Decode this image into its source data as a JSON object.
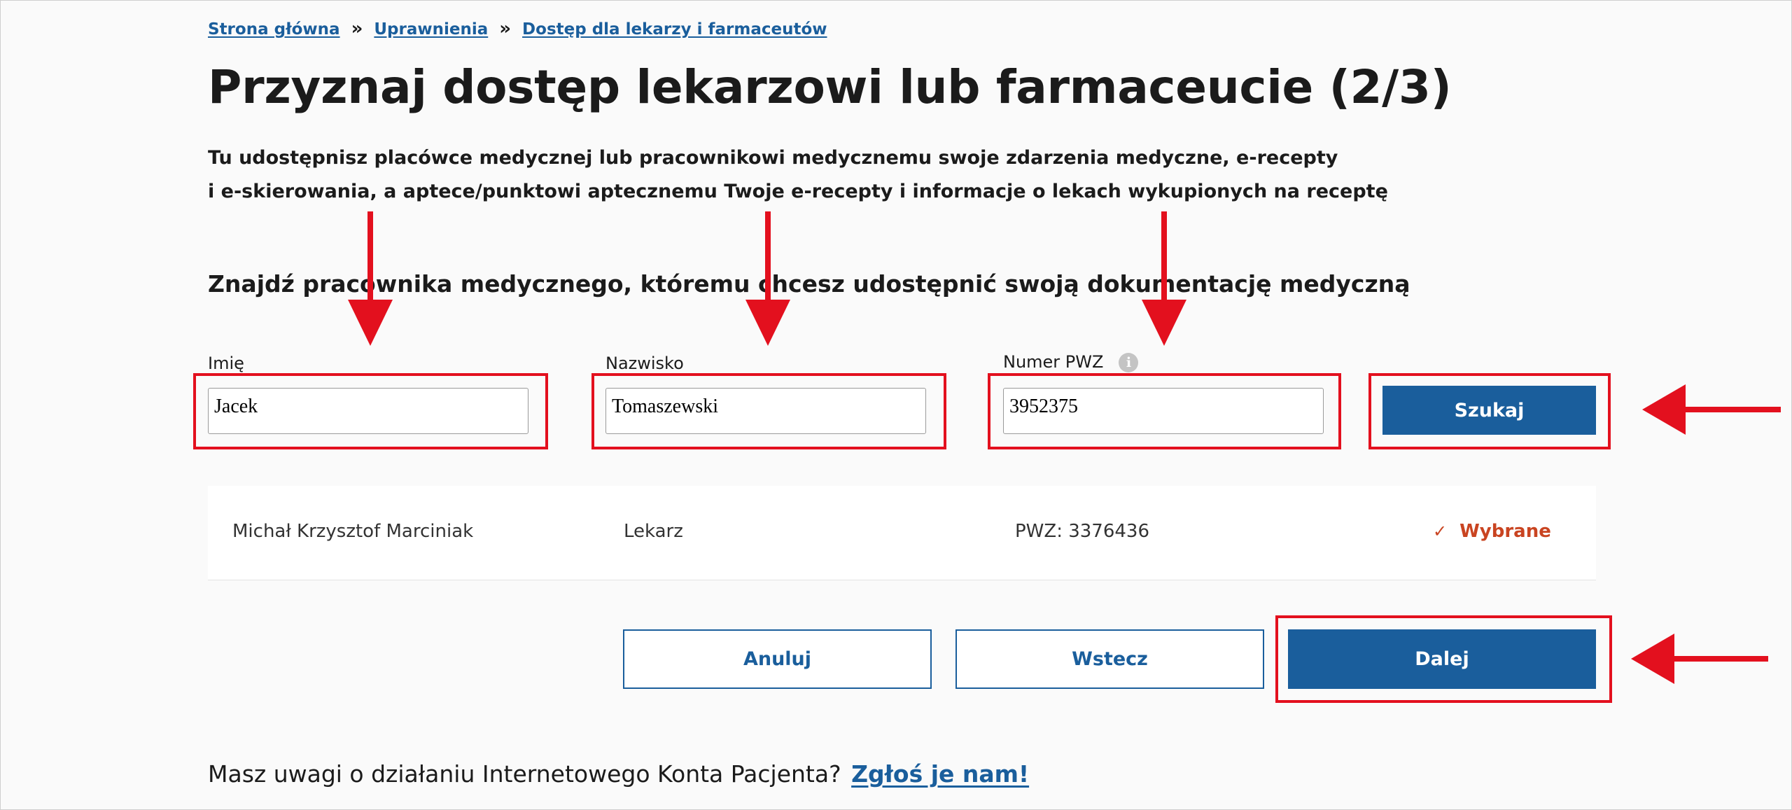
{
  "breadcrumb": {
    "home": "Strona główna",
    "permissions": "Uprawnienia",
    "current": "Dostęp dla lekarzy i farmaceutów",
    "separator": "»"
  },
  "page": {
    "title": "Przyznaj dostęp lekarzowi lub farmaceucie (2/3)",
    "intro_line1": "Tu udostępnisz placówce medycznej lub pracownikowi medycznemu swoje zdarzenia medyczne, e-recepty",
    "intro_line2": "i e-skierowania, a aptece/punktowi aptecznemu Twoje e-recepty i informacje o lekach wykupionych na receptę"
  },
  "search": {
    "heading": "Znajdź pracownika medycznego, któremu chcesz udostępnić swoją dokumentację medyczną",
    "first_name_label": "Imię",
    "first_name_value": "Jacek",
    "last_name_label": "Nazwisko",
    "last_name_value": "Tomaszewski",
    "pwz_label": "Numer PWZ",
    "pwz_info_icon": "i",
    "pwz_value": "3952375",
    "search_button": "Szukaj"
  },
  "result": {
    "name": "Michał Krzysztof Marciniak",
    "role": "Lekarz",
    "pwz": "PWZ: 3376436",
    "status": "Wybrane",
    "status_icon": "✓"
  },
  "actions": {
    "cancel": "Anuluj",
    "back": "Wstecz",
    "next": "Dalej"
  },
  "feedback": {
    "text": "Masz uwagi o działaniu Internetowego Konta Pacjenta?",
    "link": "Zgłoś je nam!"
  },
  "colors": {
    "primary": "#1a5e9c",
    "status": "#c94421",
    "annotation": "#e3101e"
  }
}
